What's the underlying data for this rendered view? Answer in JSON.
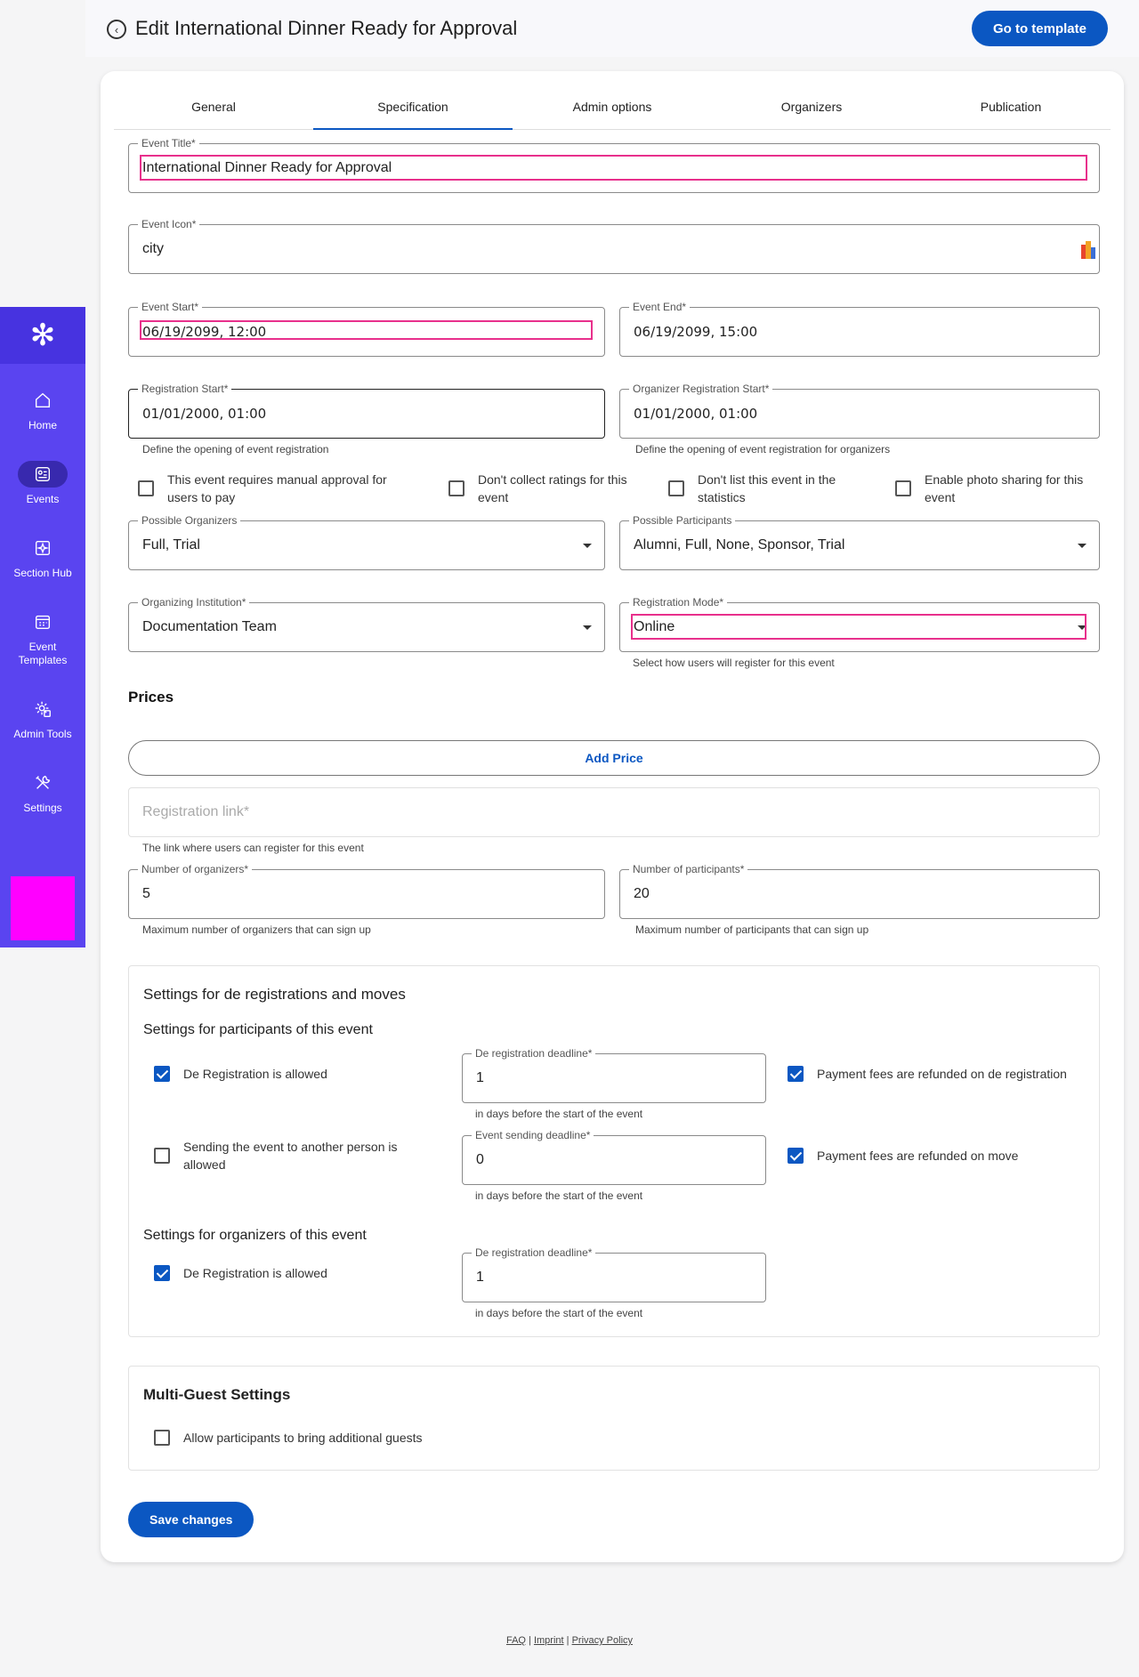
{
  "header": {
    "title": "Edit International Dinner Ready for Approval",
    "go_to_template": "Go to template"
  },
  "sidebar": {
    "items": [
      {
        "label": "Home",
        "icon": "home-icon"
      },
      {
        "label": "Events",
        "icon": "events-icon"
      },
      {
        "label": "Section Hub",
        "icon": "section-hub-icon"
      },
      {
        "label": "Event Templates",
        "icon": "event-templates-icon"
      },
      {
        "label": "Admin Tools",
        "icon": "admin-tools-icon"
      },
      {
        "label": "Settings",
        "icon": "settings-icon"
      }
    ]
  },
  "tabs": [
    "General",
    "Specification",
    "Admin options",
    "Organizers",
    "Publication"
  ],
  "form": {
    "event_title": {
      "label": "Event Title*",
      "value": "International Dinner Ready for Approval"
    },
    "event_icon": {
      "label": "Event Icon*",
      "value": "city"
    },
    "event_start": {
      "label": "Event Start*",
      "value": "06/19/2099, 12:00"
    },
    "event_end": {
      "label": "Event End*",
      "value": "06/19/2099, 15:00"
    },
    "registration_start": {
      "label": "Registration Start*",
      "value": "01/01/2000, 01:00",
      "helper": "Define the opening of event registration"
    },
    "organizer_registration_start": {
      "label": "Organizer Registration Start*",
      "value": "01/01/2000, 01:00",
      "helper": "Define the opening of event registration for organizers"
    },
    "checkboxes": [
      {
        "label": "This event requires manual approval for users to pay",
        "checked": false
      },
      {
        "label": "Don't collect ratings for this event",
        "checked": false
      },
      {
        "label": "Don't list this event in the statistics",
        "checked": false
      },
      {
        "label": "Enable photo sharing for this event",
        "checked": false
      }
    ],
    "possible_organizers": {
      "label": "Possible Organizers",
      "value": "Full, Trial"
    },
    "possible_participants": {
      "label": "Possible Participants",
      "value": "Alumni, Full, None, Sponsor, Trial"
    },
    "organizing_institution": {
      "label": "Organizing Institution*",
      "value": "Documentation Team"
    },
    "registration_mode": {
      "label": "Registration Mode*",
      "value": "Online",
      "helper": "Select how users will register for this event"
    },
    "prices_heading": "Prices",
    "add_price": "Add Price",
    "registration_link": {
      "placeholder": "Registration link*",
      "helper": "The link where users can register for this event"
    },
    "num_organizers": {
      "label": "Number of organizers*",
      "value": "5",
      "helper": "Maximum number of organizers that can sign up"
    },
    "num_participants": {
      "label": "Number of participants*",
      "value": "20",
      "helper": "Maximum number of participants that can sign up"
    }
  },
  "dereg": {
    "title": "Settings for de registrations and moves",
    "participants_title": "Settings for participants of this event",
    "p_dereg_allowed": {
      "label": "De Registration is allowed",
      "checked": true
    },
    "p_dereg_deadline": {
      "label": "De registration deadline*",
      "value": "1",
      "helper": "in days before the start of the event"
    },
    "p_refund_dereg": {
      "label": "Payment fees are refunded on de registration",
      "checked": true
    },
    "p_send_allowed": {
      "label": "Sending the event to another person is allowed",
      "checked": false
    },
    "p_send_deadline": {
      "label": "Event sending deadline*",
      "value": "0",
      "helper": "in days before the start of the event"
    },
    "p_refund_move": {
      "label": "Payment fees are refunded on move",
      "checked": true
    },
    "organizers_title": "Settings for organizers of this event",
    "o_dereg_allowed": {
      "label": "De Registration is allowed",
      "checked": true
    },
    "o_dereg_deadline": {
      "label": "De registration deadline*",
      "value": "1",
      "helper": "in days before the start of the event"
    }
  },
  "multi_guest": {
    "title": "Multi-Guest Settings",
    "allow_guests": {
      "label": "Allow participants to bring additional guests",
      "checked": false
    }
  },
  "save_changes": "Save changes",
  "footer": {
    "faq": "FAQ",
    "sep": "|",
    "imprint": "Imprint",
    "privacy": "Privacy Policy"
  },
  "colors": {
    "primary": "#0b57c2",
    "sidebar": "#5a44f0",
    "highlight": "#e8308c",
    "magenta": "#ff00ff"
  }
}
